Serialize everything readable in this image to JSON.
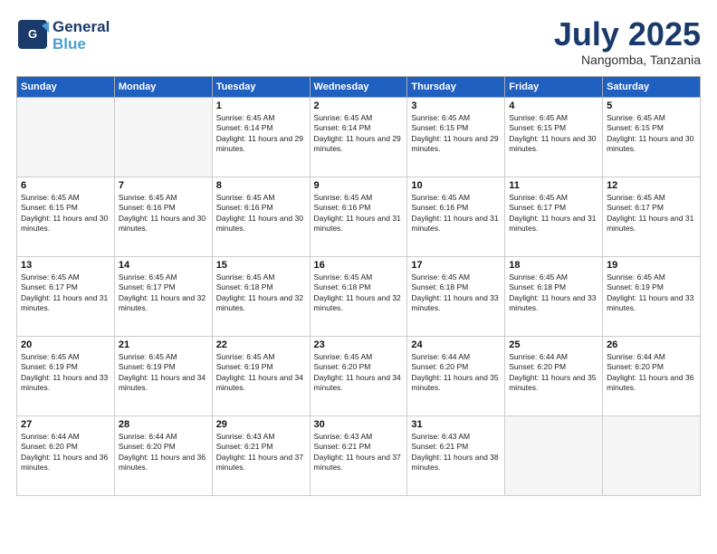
{
  "header": {
    "logo_general": "General",
    "logo_blue": "Blue",
    "month": "July 2025",
    "location": "Nangomba, Tanzania"
  },
  "days_of_week": [
    "Sunday",
    "Monday",
    "Tuesday",
    "Wednesday",
    "Thursday",
    "Friday",
    "Saturday"
  ],
  "weeks": [
    [
      {
        "day": "",
        "empty": true
      },
      {
        "day": "",
        "empty": true
      },
      {
        "day": "1",
        "sunrise": "Sunrise: 6:45 AM",
        "sunset": "Sunset: 6:14 PM",
        "daylight": "Daylight: 11 hours and 29 minutes."
      },
      {
        "day": "2",
        "sunrise": "Sunrise: 6:45 AM",
        "sunset": "Sunset: 6:14 PM",
        "daylight": "Daylight: 11 hours and 29 minutes."
      },
      {
        "day": "3",
        "sunrise": "Sunrise: 6:45 AM",
        "sunset": "Sunset: 6:15 PM",
        "daylight": "Daylight: 11 hours and 29 minutes."
      },
      {
        "day": "4",
        "sunrise": "Sunrise: 6:45 AM",
        "sunset": "Sunset: 6:15 PM",
        "daylight": "Daylight: 11 hours and 30 minutes."
      },
      {
        "day": "5",
        "sunrise": "Sunrise: 6:45 AM",
        "sunset": "Sunset: 6:15 PM",
        "daylight": "Daylight: 11 hours and 30 minutes."
      }
    ],
    [
      {
        "day": "6",
        "sunrise": "Sunrise: 6:45 AM",
        "sunset": "Sunset: 6:15 PM",
        "daylight": "Daylight: 11 hours and 30 minutes."
      },
      {
        "day": "7",
        "sunrise": "Sunrise: 6:45 AM",
        "sunset": "Sunset: 6:16 PM",
        "daylight": "Daylight: 11 hours and 30 minutes."
      },
      {
        "day": "8",
        "sunrise": "Sunrise: 6:45 AM",
        "sunset": "Sunset: 6:16 PM",
        "daylight": "Daylight: 11 hours and 30 minutes."
      },
      {
        "day": "9",
        "sunrise": "Sunrise: 6:45 AM",
        "sunset": "Sunset: 6:16 PM",
        "daylight": "Daylight: 11 hours and 31 minutes."
      },
      {
        "day": "10",
        "sunrise": "Sunrise: 6:45 AM",
        "sunset": "Sunset: 6:16 PM",
        "daylight": "Daylight: 11 hours and 31 minutes."
      },
      {
        "day": "11",
        "sunrise": "Sunrise: 6:45 AM",
        "sunset": "Sunset: 6:17 PM",
        "daylight": "Daylight: 11 hours and 31 minutes."
      },
      {
        "day": "12",
        "sunrise": "Sunrise: 6:45 AM",
        "sunset": "Sunset: 6:17 PM",
        "daylight": "Daylight: 11 hours and 31 minutes."
      }
    ],
    [
      {
        "day": "13",
        "sunrise": "Sunrise: 6:45 AM",
        "sunset": "Sunset: 6:17 PM",
        "daylight": "Daylight: 11 hours and 31 minutes."
      },
      {
        "day": "14",
        "sunrise": "Sunrise: 6:45 AM",
        "sunset": "Sunset: 6:17 PM",
        "daylight": "Daylight: 11 hours and 32 minutes."
      },
      {
        "day": "15",
        "sunrise": "Sunrise: 6:45 AM",
        "sunset": "Sunset: 6:18 PM",
        "daylight": "Daylight: 11 hours and 32 minutes."
      },
      {
        "day": "16",
        "sunrise": "Sunrise: 6:45 AM",
        "sunset": "Sunset: 6:18 PM",
        "daylight": "Daylight: 11 hours and 32 minutes."
      },
      {
        "day": "17",
        "sunrise": "Sunrise: 6:45 AM",
        "sunset": "Sunset: 6:18 PM",
        "daylight": "Daylight: 11 hours and 33 minutes."
      },
      {
        "day": "18",
        "sunrise": "Sunrise: 6:45 AM",
        "sunset": "Sunset: 6:18 PM",
        "daylight": "Daylight: 11 hours and 33 minutes."
      },
      {
        "day": "19",
        "sunrise": "Sunrise: 6:45 AM",
        "sunset": "Sunset: 6:19 PM",
        "daylight": "Daylight: 11 hours and 33 minutes."
      }
    ],
    [
      {
        "day": "20",
        "sunrise": "Sunrise: 6:45 AM",
        "sunset": "Sunset: 6:19 PM",
        "daylight": "Daylight: 11 hours and 33 minutes."
      },
      {
        "day": "21",
        "sunrise": "Sunrise: 6:45 AM",
        "sunset": "Sunset: 6:19 PM",
        "daylight": "Daylight: 11 hours and 34 minutes."
      },
      {
        "day": "22",
        "sunrise": "Sunrise: 6:45 AM",
        "sunset": "Sunset: 6:19 PM",
        "daylight": "Daylight: 11 hours and 34 minutes."
      },
      {
        "day": "23",
        "sunrise": "Sunrise: 6:45 AM",
        "sunset": "Sunset: 6:20 PM",
        "daylight": "Daylight: 11 hours and 34 minutes."
      },
      {
        "day": "24",
        "sunrise": "Sunrise: 6:44 AM",
        "sunset": "Sunset: 6:20 PM",
        "daylight": "Daylight: 11 hours and 35 minutes."
      },
      {
        "day": "25",
        "sunrise": "Sunrise: 6:44 AM",
        "sunset": "Sunset: 6:20 PM",
        "daylight": "Daylight: 11 hours and 35 minutes."
      },
      {
        "day": "26",
        "sunrise": "Sunrise: 6:44 AM",
        "sunset": "Sunset: 6:20 PM",
        "daylight": "Daylight: 11 hours and 36 minutes."
      }
    ],
    [
      {
        "day": "27",
        "sunrise": "Sunrise: 6:44 AM",
        "sunset": "Sunset: 6:20 PM",
        "daylight": "Daylight: 11 hours and 36 minutes."
      },
      {
        "day": "28",
        "sunrise": "Sunrise: 6:44 AM",
        "sunset": "Sunset: 6:20 PM",
        "daylight": "Daylight: 11 hours and 36 minutes."
      },
      {
        "day": "29",
        "sunrise": "Sunrise: 6:43 AM",
        "sunset": "Sunset: 6:21 PM",
        "daylight": "Daylight: 11 hours and 37 minutes."
      },
      {
        "day": "30",
        "sunrise": "Sunrise: 6:43 AM",
        "sunset": "Sunset: 6:21 PM",
        "daylight": "Daylight: 11 hours and 37 minutes."
      },
      {
        "day": "31",
        "sunrise": "Sunrise: 6:43 AM",
        "sunset": "Sunset: 6:21 PM",
        "daylight": "Daylight: 11 hours and 38 minutes."
      },
      {
        "day": "",
        "empty": true
      },
      {
        "day": "",
        "empty": true
      }
    ]
  ]
}
